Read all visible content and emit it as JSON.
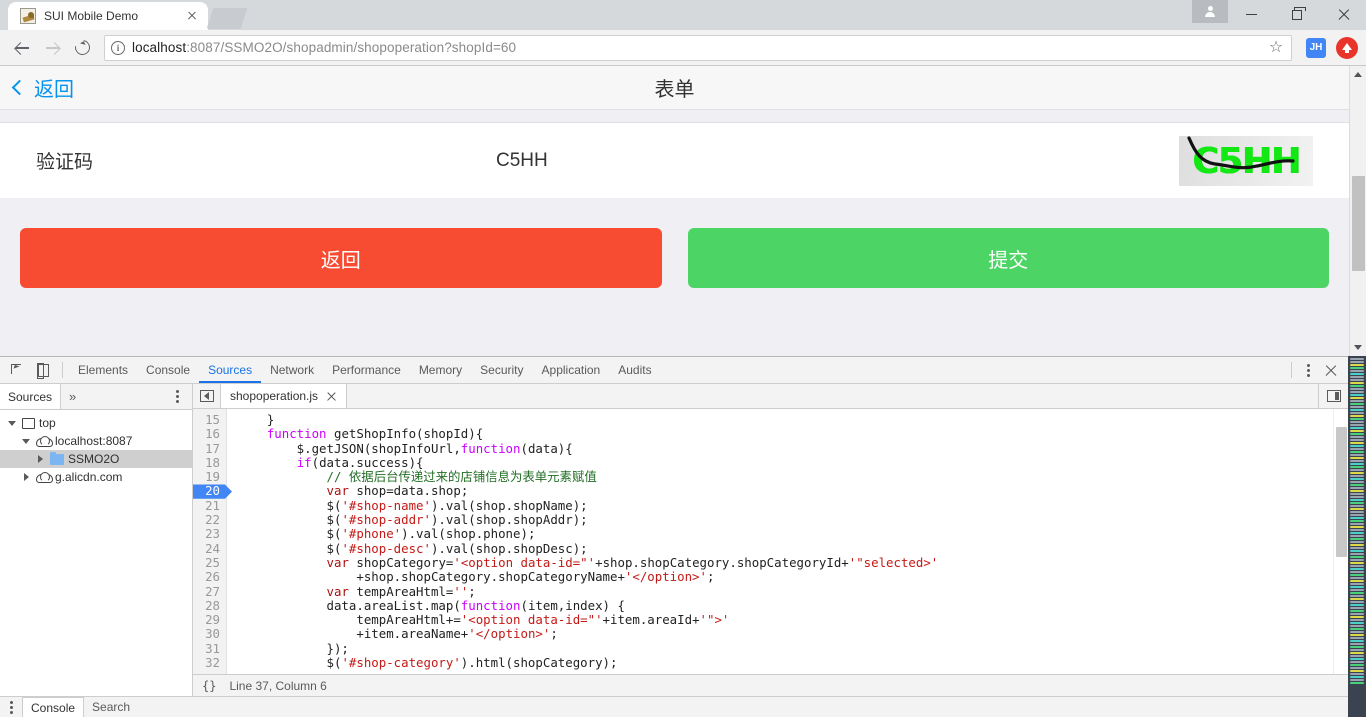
{
  "browser": {
    "tab": {
      "title": "SUI Mobile Demo",
      "favicon": "image-favicon",
      "close": "×"
    },
    "newtab_label": "+",
    "window_controls": {
      "avatar": "user-avatar",
      "minimize": "−",
      "maximize": "□",
      "close": "×"
    },
    "toolbar": {
      "back": "←",
      "forward": "→",
      "reload": "⟳",
      "security_icon": "i",
      "url_host": "localhost",
      "url_rest": ":8087/SSMO2O/shopadmin/shopoperation?shopId=60",
      "url_full": "localhost:8087/SSMO2O/shopadmin/shopoperation?shopId=60",
      "bookmark": "☆",
      "extension_jh": "JH",
      "extension_red": "upload-icon"
    }
  },
  "page": {
    "navbar": {
      "back_label": "返回",
      "title": "表单"
    },
    "captcha_row": {
      "label": "验证码",
      "value": "C5HH",
      "image_text": "C5HH",
      "image_color": "#14e814"
    },
    "actions": {
      "back": {
        "label": "返回",
        "color": "#f74c31"
      },
      "submit": {
        "label": "提交",
        "color": "#4cd464"
      }
    }
  },
  "devtools": {
    "tabs": [
      {
        "label": "Elements",
        "active": false
      },
      {
        "label": "Console",
        "active": false
      },
      {
        "label": "Sources",
        "active": true
      },
      {
        "label": "Network",
        "active": false
      },
      {
        "label": "Performance",
        "active": false
      },
      {
        "label": "Memory",
        "active": false
      },
      {
        "label": "Security",
        "active": false
      },
      {
        "label": "Application",
        "active": false
      },
      {
        "label": "Audits",
        "active": false
      }
    ],
    "accent": "#1a73e8",
    "navigator": {
      "tab_label": "Sources",
      "more_label": "»",
      "tree": [
        {
          "label": "top",
          "indent": 0,
          "icon": "frame-icon",
          "twisty": "down",
          "selected": false
        },
        {
          "label": "localhost:8087",
          "indent": 1,
          "icon": "cloud-icon",
          "twisty": "down",
          "selected": false
        },
        {
          "label": "SSMO2O",
          "indent": 2,
          "icon": "folder-icon",
          "twisty": "right",
          "selected": true
        },
        {
          "label": "g.alicdn.com",
          "indent": 1,
          "icon": "cloud-icon",
          "twisty": "right",
          "selected": false
        }
      ]
    },
    "editor": {
      "file_tab": "shopoperation.js",
      "file_tab_close": "×",
      "pretty_print": "{}",
      "status": "Line 37, Column 6",
      "breakpoint_line": 20,
      "first_line": 15,
      "lines": [
        {
          "n": 15,
          "tokens": [
            [
              "pl",
              "    }"
            ]
          ]
        },
        {
          "n": 16,
          "tokens": [
            [
              "pl",
              "    "
            ],
            [
              "kw2",
              "function"
            ],
            [
              "pl",
              " getShopInfo(shopId){"
            ]
          ]
        },
        {
          "n": 17,
          "tokens": [
            [
              "pl",
              "        $.getJSON(shopInfoUrl,"
            ],
            [
              "kw2",
              "function"
            ],
            [
              "pl",
              "(data){"
            ]
          ]
        },
        {
          "n": 18,
          "tokens": [
            [
              "pl",
              "        "
            ],
            [
              "kw2",
              "if"
            ],
            [
              "pl",
              "(data.success){"
            ]
          ]
        },
        {
          "n": 19,
          "tokens": [
            [
              "pl",
              "            "
            ],
            [
              "cmt",
              "// 依据后台传递过来的店铺信息为表单元素赋值"
            ]
          ]
        },
        {
          "n": 20,
          "tokens": [
            [
              "pl",
              "            "
            ],
            [
              "kw",
              "var"
            ],
            [
              "pl",
              " shop=data.shop;"
            ]
          ]
        },
        {
          "n": 21,
          "tokens": [
            [
              "pl",
              "            $("
            ],
            [
              "str",
              "'#shop-name'"
            ],
            [
              "pl",
              ").val(shop.shopName);"
            ]
          ]
        },
        {
          "n": 22,
          "tokens": [
            [
              "pl",
              "            $("
            ],
            [
              "str",
              "'#shop-addr'"
            ],
            [
              "pl",
              ").val(shop.shopAddr);"
            ]
          ]
        },
        {
          "n": 23,
          "tokens": [
            [
              "pl",
              "            $("
            ],
            [
              "str",
              "'#phone'"
            ],
            [
              "pl",
              ").val(shop.phone);"
            ]
          ]
        },
        {
          "n": 24,
          "tokens": [
            [
              "pl",
              "            $("
            ],
            [
              "str",
              "'#shop-desc'"
            ],
            [
              "pl",
              ").val(shop.shopDesc);"
            ]
          ]
        },
        {
          "n": 25,
          "tokens": [
            [
              "pl",
              "            "
            ],
            [
              "kw",
              "var"
            ],
            [
              "pl",
              " shopCategory="
            ],
            [
              "str",
              "'<option data-id=\"'"
            ],
            [
              "pl",
              "+shop.shopCategory.shopCategoryId+"
            ],
            [
              "str",
              "'\"selected>'"
            ]
          ]
        },
        {
          "n": 26,
          "tokens": [
            [
              "pl",
              "                +shop.shopCategory.shopCategoryName+"
            ],
            [
              "str",
              "'</option>'"
            ],
            [
              "pl",
              ";"
            ]
          ]
        },
        {
          "n": 27,
          "tokens": [
            [
              "pl",
              "            "
            ],
            [
              "kw",
              "var"
            ],
            [
              "pl",
              " tempAreaHtml="
            ],
            [
              "str",
              "''"
            ],
            [
              "pl",
              ";"
            ]
          ]
        },
        {
          "n": 28,
          "tokens": [
            [
              "pl",
              "            data.areaList.map("
            ],
            [
              "kw2",
              "function"
            ],
            [
              "pl",
              "(item,index) {"
            ]
          ]
        },
        {
          "n": 29,
          "tokens": [
            [
              "pl",
              "                tempAreaHtml+="
            ],
            [
              "str",
              "'<option data-id=\"'"
            ],
            [
              "pl",
              "+item.areaId+"
            ],
            [
              "str",
              "'\">'"
            ]
          ]
        },
        {
          "n": 30,
          "tokens": [
            [
              "pl",
              "                +item.areaName+"
            ],
            [
              "str",
              "'</option>'"
            ],
            [
              "pl",
              ";"
            ]
          ]
        },
        {
          "n": 31,
          "tokens": [
            [
              "pl",
              "            });"
            ]
          ]
        },
        {
          "n": 32,
          "tokens": [
            [
              "pl",
              "            $("
            ],
            [
              "str",
              "'#shop-category'"
            ],
            [
              "pl",
              ").html(shopCategory);"
            ]
          ]
        }
      ]
    },
    "drawer": {
      "tabs": [
        {
          "label": "Console",
          "active": true
        },
        {
          "label": "Search",
          "active": false
        }
      ]
    }
  }
}
